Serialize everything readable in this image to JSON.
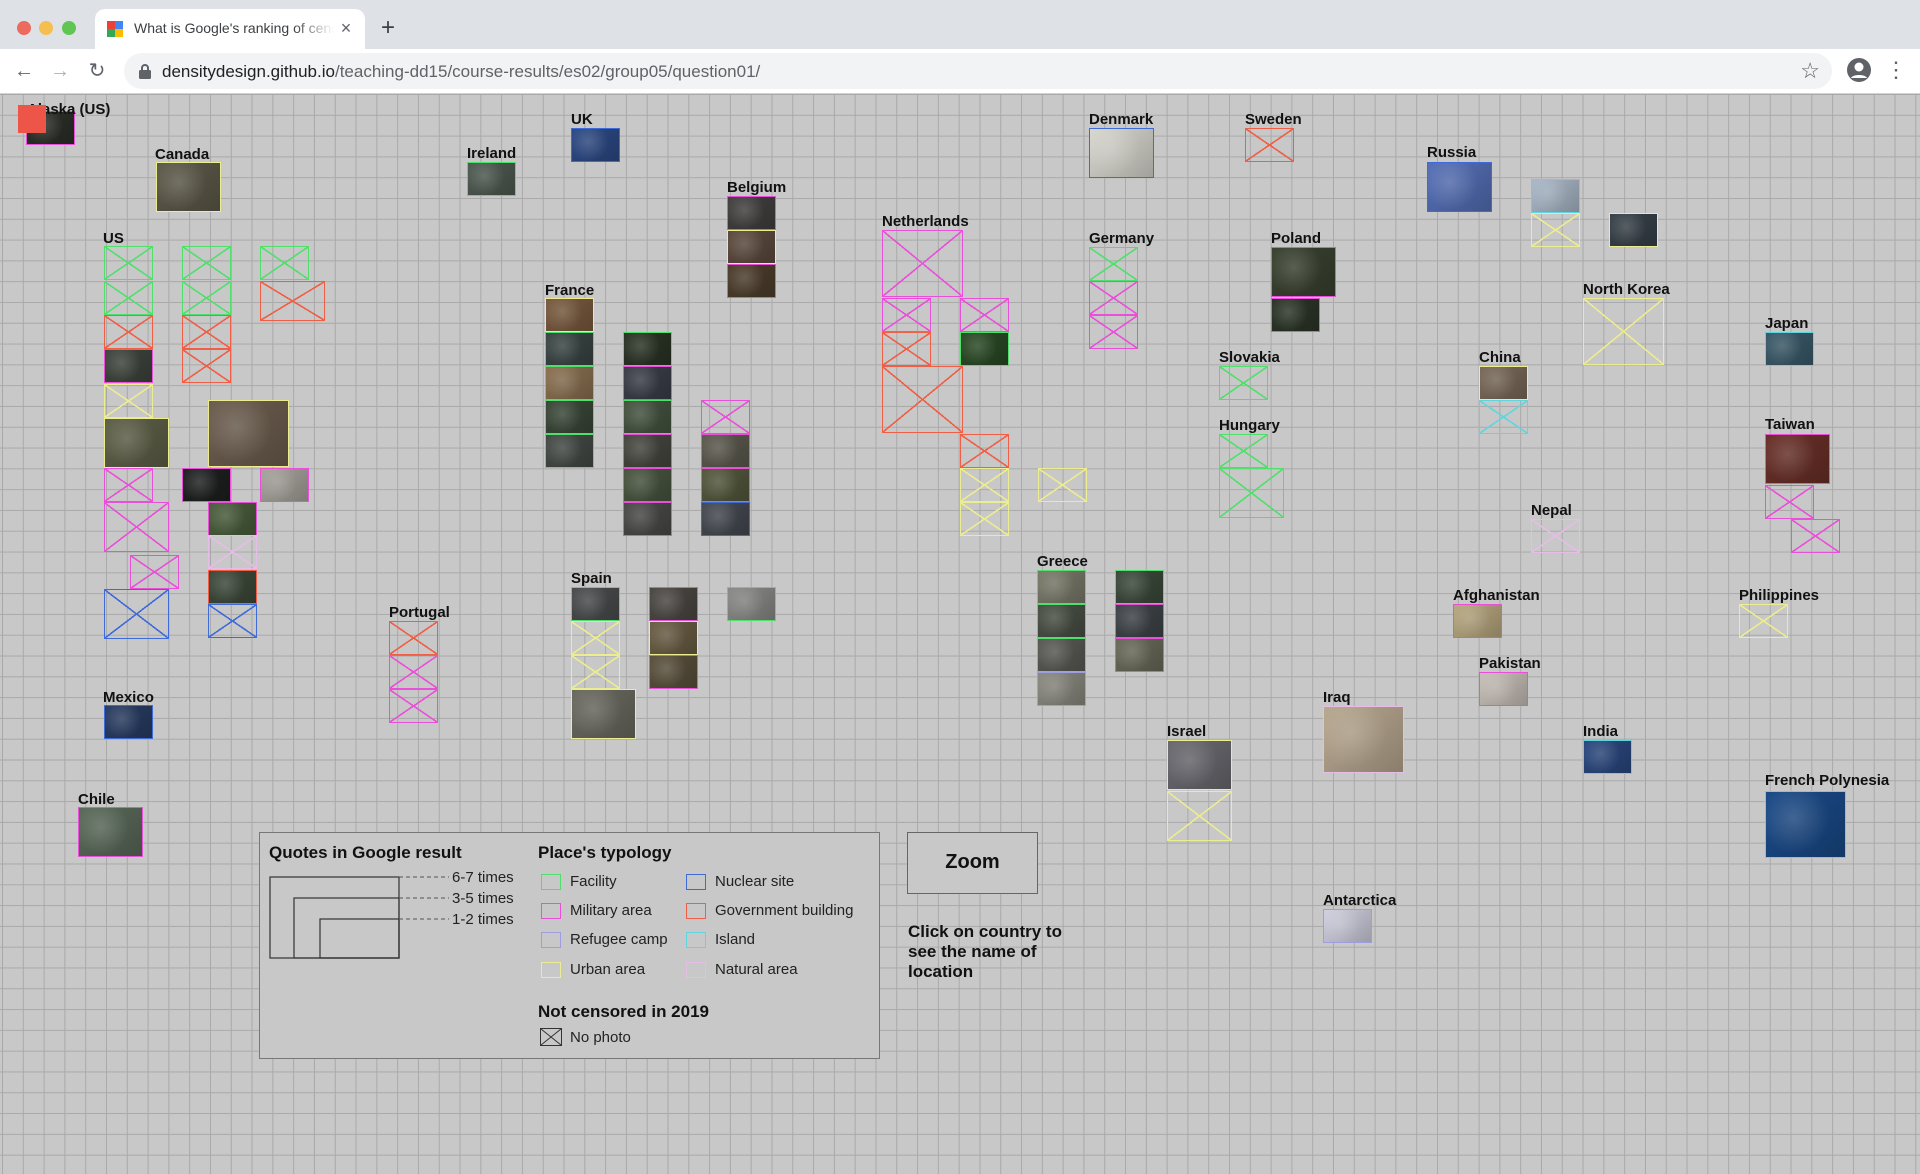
{
  "browser": {
    "tab_title": "What is Google's ranking of censored places",
    "url_host": "densitydesign.github.io",
    "url_path": "/teaching-dd15/course-results/es02/group05/question01/"
  },
  "page": {
    "countries": [
      "Alaska (US)",
      "Canada",
      "US",
      "Mexico",
      "Chile",
      "Ireland",
      "UK",
      "Portugal",
      "Belgium",
      "France",
      "Spain",
      "Netherlands",
      "Denmark",
      "Germany",
      "Sweden",
      "Poland",
      "Slovakia",
      "Hungary",
      "Greece",
      "Israel",
      "Iraq",
      "Russia",
      "North Korea",
      "China",
      "Japan",
      "Taiwan",
      "Nepal",
      "Afghanistan",
      "Pakistan",
      "India",
      "Philippines",
      "French Polynesia",
      "Antarctica"
    ],
    "zoom_label": "Zoom",
    "hint": "Click on country to see the name of location"
  },
  "legend": {
    "quotes_title": "Quotes in Google result",
    "quotes": [
      "6-7 times",
      "3-5 times",
      "1-2 times"
    ],
    "typology_title": "Place's typology",
    "typology": [
      {
        "label": "Facility",
        "color": "#4fe06b"
      },
      {
        "label": "Nuclear site",
        "color": "#3f6bd9"
      },
      {
        "label": "Military area",
        "color": "#e94fd9"
      },
      {
        "label": "Government building",
        "color": "#ef5e45"
      },
      {
        "label": "Refugee camp",
        "color": "#9d9de0"
      },
      {
        "label": "Island",
        "color": "#5fd6de"
      },
      {
        "label": "Urban area",
        "color": "#ecec90"
      },
      {
        "label": "Natural area",
        "color": "#e6bde6"
      }
    ],
    "not_censored_title": "Not censored in 2019",
    "no_photo": "No photo"
  }
}
